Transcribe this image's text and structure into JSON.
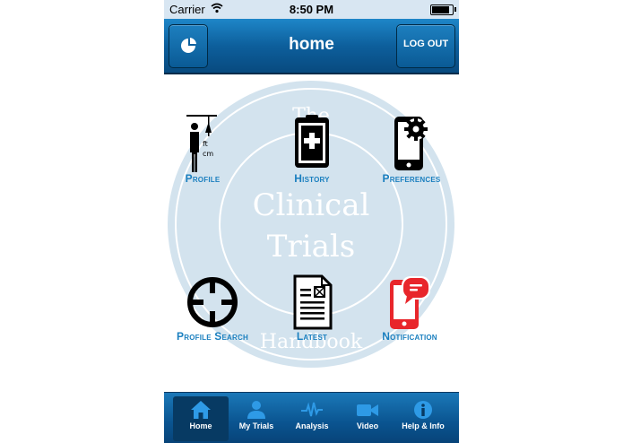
{
  "status_bar": {
    "carrier": "Carrier",
    "time": "8:50 PM",
    "battery_level": 0.95
  },
  "nav": {
    "title": "home",
    "logout_label": "LOG OUT"
  },
  "watermark": {
    "line1": "The",
    "line2": "Clinical",
    "line3": "Trials",
    "line4": "Handbook"
  },
  "menu": {
    "profile": "Profile",
    "history": "History",
    "preferences": "Preferences",
    "profile_search": "Profile Search",
    "latest": "Latest",
    "notification": "Notification",
    "profile_units": [
      "ft",
      "cm"
    ]
  },
  "tabs": [
    {
      "label": "Home",
      "icon": "home-icon"
    },
    {
      "label": "My Trials",
      "icon": "person-icon"
    },
    {
      "label": "Analysis",
      "icon": "pulse-icon"
    },
    {
      "label": "Video",
      "icon": "video-camera-icon"
    },
    {
      "label": "Help & Info",
      "icon": "info-icon"
    }
  ],
  "colors": {
    "accent": "#1a7fbf",
    "nav": "#0d5f9c",
    "notification": "#e8262b"
  }
}
